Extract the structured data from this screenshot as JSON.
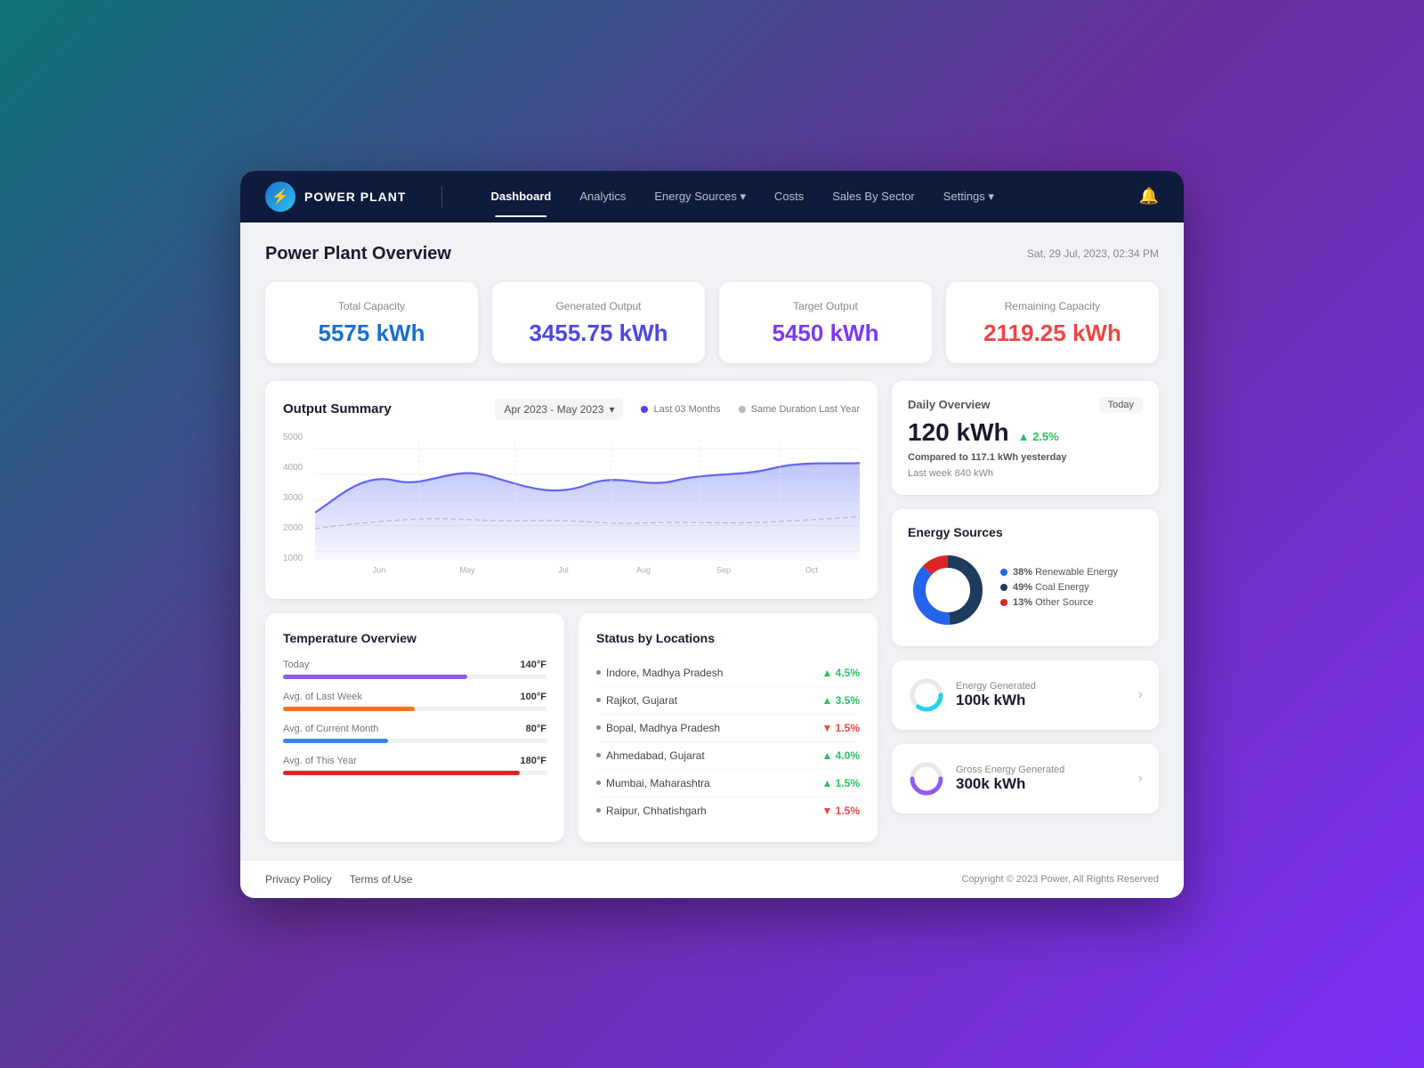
{
  "brand": {
    "name": "POWER PLANT",
    "icon": "⚡"
  },
  "nav": {
    "items": [
      {
        "label": "Dashboard",
        "active": true,
        "hasDropdown": false
      },
      {
        "label": "Analytics",
        "active": false,
        "hasDropdown": false
      },
      {
        "label": "Energy Sources",
        "active": false,
        "hasDropdown": true
      },
      {
        "label": "Costs",
        "active": false,
        "hasDropdown": false
      },
      {
        "label": "Sales By Sector",
        "active": false,
        "hasDropdown": false
      },
      {
        "label": "Settings",
        "active": false,
        "hasDropdown": true
      }
    ]
  },
  "header": {
    "title": "Power Plant Overview",
    "datetime": "Sat, 29 Jul, 2023, 02:34 PM"
  },
  "stats": [
    {
      "label": "Total Capacity",
      "value": "5575 kWh",
      "colorClass": "blue"
    },
    {
      "label": "Generated Output",
      "value": "3455.75 kWh",
      "colorClass": "indigo"
    },
    {
      "label": "Target Output",
      "value": "5450 kWh",
      "colorClass": "purple"
    },
    {
      "label": "Remaining Capacity",
      "value": "2119.25 kWh",
      "colorClass": "red"
    }
  ],
  "outputSummary": {
    "title": "Output Summary",
    "dateRange": "Apr 2023 - May 2023",
    "legend": [
      {
        "label": "Last 03 Months",
        "colorClass": "blue"
      },
      {
        "label": "Same Duration Last Year",
        "colorClass": "gray"
      }
    ],
    "yLabels": [
      "5000",
      "4000",
      "3000",
      "2000",
      "1000"
    ],
    "xLabels": [
      "Jun",
      "May",
      "Jul",
      "Aug",
      "Sep",
      "Oct"
    ]
  },
  "temperatureOverview": {
    "title": "Temperature Overview",
    "rows": [
      {
        "label": "Today",
        "value": "140°F",
        "percent": 70,
        "color": "#8b5cf6"
      },
      {
        "label": "Avg. of Last Week",
        "value": "100°F",
        "percent": 50,
        "color": "#f97316"
      },
      {
        "label": "Avg. of Current Month",
        "value": "80°F",
        "percent": 40,
        "color": "#3b82f6"
      },
      {
        "label": "Avg. of This Year",
        "value": "180°F",
        "percent": 90,
        "color": "#dc2626"
      }
    ]
  },
  "statusLocations": {
    "title": "Status by Locations",
    "rows": [
      {
        "location": "Indore, Madhya Pradesh",
        "change": "▲ 4.5%",
        "dir": "up"
      },
      {
        "location": "Rajkot, Gujarat",
        "change": "▲ 3.5%",
        "dir": "up"
      },
      {
        "location": "Bopal, Madhya Pradesh",
        "change": "▼ 1.5%",
        "dir": "down"
      },
      {
        "location": "Ahmedabad, Gujarat",
        "change": "▲ 4.0%",
        "dir": "up"
      },
      {
        "location": "Mumbai, Maharashtra",
        "change": "▲ 1.5%",
        "dir": "up"
      },
      {
        "location": "Raipur, Chhatishgarh",
        "change": "▼ 1.5%",
        "dir": "down"
      }
    ]
  },
  "dailyOverview": {
    "title": "Daily Overview",
    "badge": "Today",
    "value": "120 kWh",
    "change": "▲ 2.5%",
    "compare": "Compared to",
    "yesterday": "117.1 kWh",
    "yesterdayLabel": "yesterday",
    "lastWeek": "Last week 840 kWh"
  },
  "energySources": {
    "title": "Energy Sources",
    "segments": [
      {
        "label": "Renewable Energy",
        "pct": "38%",
        "color": "#2563eb"
      },
      {
        "label": "Coal Energy",
        "pct": "49%",
        "color": "#1e3a5f"
      },
      {
        "label": "Other Source",
        "pct": "13%",
        "color": "#dc2626"
      }
    ]
  },
  "energyGenerated": {
    "label": "Energy Generated",
    "value": "100k kWh",
    "ringColor": "#22d3ee"
  },
  "grossEnergyGenerated": {
    "label": "Gross Energy Generated",
    "value": "300k kWh",
    "ringColor": "#8b5cf6"
  },
  "footer": {
    "links": [
      "Privacy Policy",
      "Terms of Use"
    ],
    "copy": "Copyright © 2023 Power, All Rights Reserved"
  }
}
